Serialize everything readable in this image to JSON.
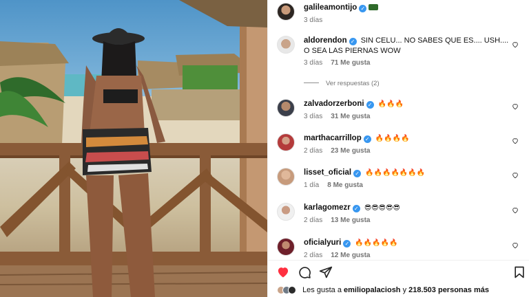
{
  "post": {
    "author": "galileamontijo",
    "time": "3 días"
  },
  "comments": [
    {
      "user": "aldorendon",
      "text": "SIN CELU... NO SABES QUE ES.... USH.... O SEA LAS PIERNAS WOW",
      "time": "3 días",
      "likes": "71 Me gusta",
      "replies": "Ver respuestas (2)"
    },
    {
      "user": "zalvadorzerboni",
      "text": "🔥🔥🔥",
      "time": "3 días",
      "likes": "31 Me gusta"
    },
    {
      "user": "marthacarrillop",
      "text": "🔥🔥🔥🔥",
      "time": "2 días",
      "likes": "23 Me gusta"
    },
    {
      "user": "lisset_oficial",
      "text": "🔥🔥🔥🔥🔥🔥🔥",
      "time": "1 día",
      "likes": "8 Me gusta"
    },
    {
      "user": "karlagomezr",
      "text": "😎😎😎😎😎",
      "time": "2 días",
      "likes": "13 Me gusta"
    },
    {
      "user": "oficialyuri",
      "text": "🔥🔥🔥🔥🔥",
      "time": "2 días",
      "likes": "12 Me gusta"
    }
  ],
  "likes_summary": {
    "prefix": "Les gusta a",
    "user": "emiliopalaciosh",
    "conjunction": "y",
    "count": "218.503 personas más"
  },
  "icons": {
    "like": "heart-icon",
    "comment": "comment-icon",
    "share": "share-icon",
    "save": "bookmark-icon"
  },
  "colors": {
    "like_active": "#ff3040",
    "verified": "#3897f0",
    "meta_text": "#737373"
  }
}
